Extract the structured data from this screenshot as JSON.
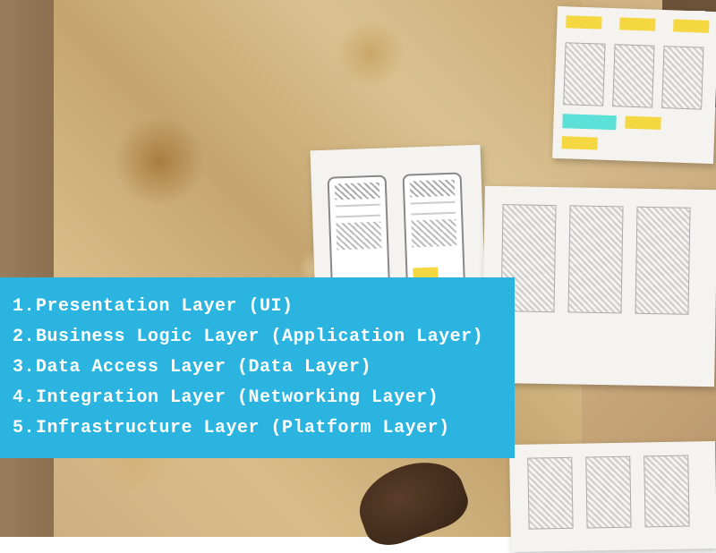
{
  "panel": {
    "items": [
      "Presentation Layer (UI)",
      "Business Logic Layer (Application Layer)",
      "Data Access Layer (Data Layer)",
      "Integration Layer (Networking Layer)",
      "Infrastructure Layer (Platform Layer)"
    ]
  }
}
